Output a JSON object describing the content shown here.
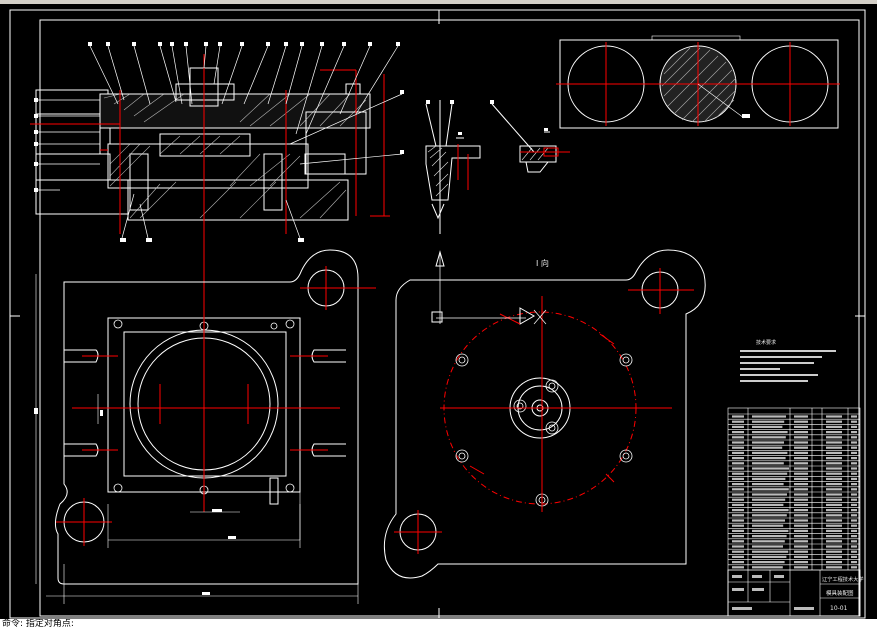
{
  "drawing": {
    "view_label": "I 向",
    "tech_requirements_title": "技术要求",
    "school": "辽宁工程技术大学",
    "drawing_name": "模具装配图",
    "drawing_number": "10-01"
  },
  "command_line": "命令: 指定对角点:",
  "colors": {
    "background": "#000000",
    "outline": "#ffffff",
    "centerline": "#ff0000",
    "hatch": "#ffffff"
  }
}
